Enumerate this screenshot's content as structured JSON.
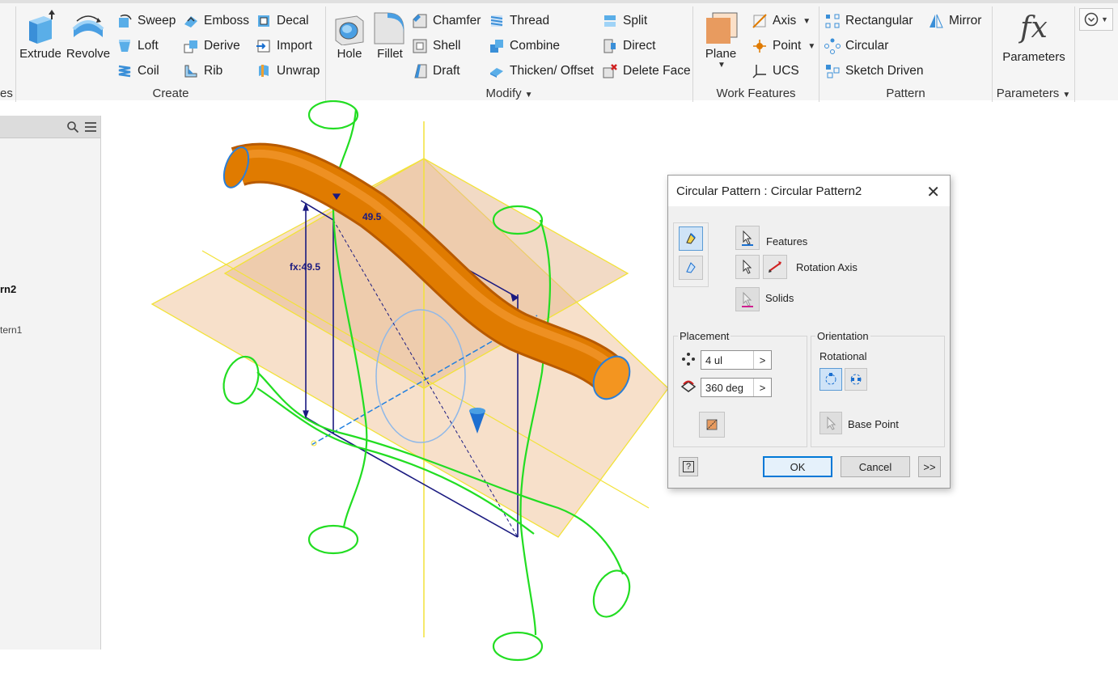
{
  "ribbon": {
    "partial_panel_label": "es",
    "create": {
      "label": "Create",
      "extrude": "Extrude",
      "revolve": "Revolve",
      "sweep": "Sweep",
      "emboss": "Emboss",
      "decal": "Decal",
      "loft": "Loft",
      "derive": "Derive",
      "import": "Import",
      "coil": "Coil",
      "rib": "Rib",
      "unwrap": "Unwrap"
    },
    "modify": {
      "label": "Modify",
      "hole": "Hole",
      "fillet": "Fillet",
      "chamfer": "Chamfer",
      "thread": "Thread",
      "split": "Split",
      "shell": "Shell",
      "combine": "Combine",
      "direct": "Direct",
      "draft": "Draft",
      "thicken_offset": "Thicken/ Offset",
      "delete_face": "Delete Face"
    },
    "work_features": {
      "label": "Work Features",
      "plane": "Plane",
      "axis": "Axis",
      "point": "Point",
      "ucs": "UCS"
    },
    "pattern": {
      "label": "Pattern",
      "rectangular": "Rectangular",
      "mirror": "Mirror",
      "circular": "Circular",
      "sketch_driven": "Sketch Driven"
    },
    "parameters": {
      "label": "Parameters",
      "button": "Parameters"
    }
  },
  "browser": {
    "item_pattern2": "rn2",
    "item_pattern1": "tern1"
  },
  "viewport": {
    "dimension_linear": "49.5",
    "dimension_fx": "fx:49.5"
  },
  "dialog": {
    "title": "Circular Pattern : Circular Pattern2",
    "features_label": "Features",
    "rotation_axis_label": "Rotation Axis",
    "solids_label": "Solids",
    "placement_label": "Placement",
    "count_value": "4 ul",
    "angle_value": "360 deg",
    "orientation_label": "Orientation",
    "rotational_label": "Rotational",
    "base_point_label": "Base Point",
    "ok": "OK",
    "cancel": "Cancel",
    "more": ">>",
    "help": "?"
  },
  "colors": {
    "accent_blue": "#0078d7",
    "tube_orange": "#e07b00",
    "sketch_green": "#22dd22",
    "plane_fill": "#f4d5b8",
    "plane_edge": "#f2e23a",
    "dimension_navy": "#1a1a80"
  }
}
